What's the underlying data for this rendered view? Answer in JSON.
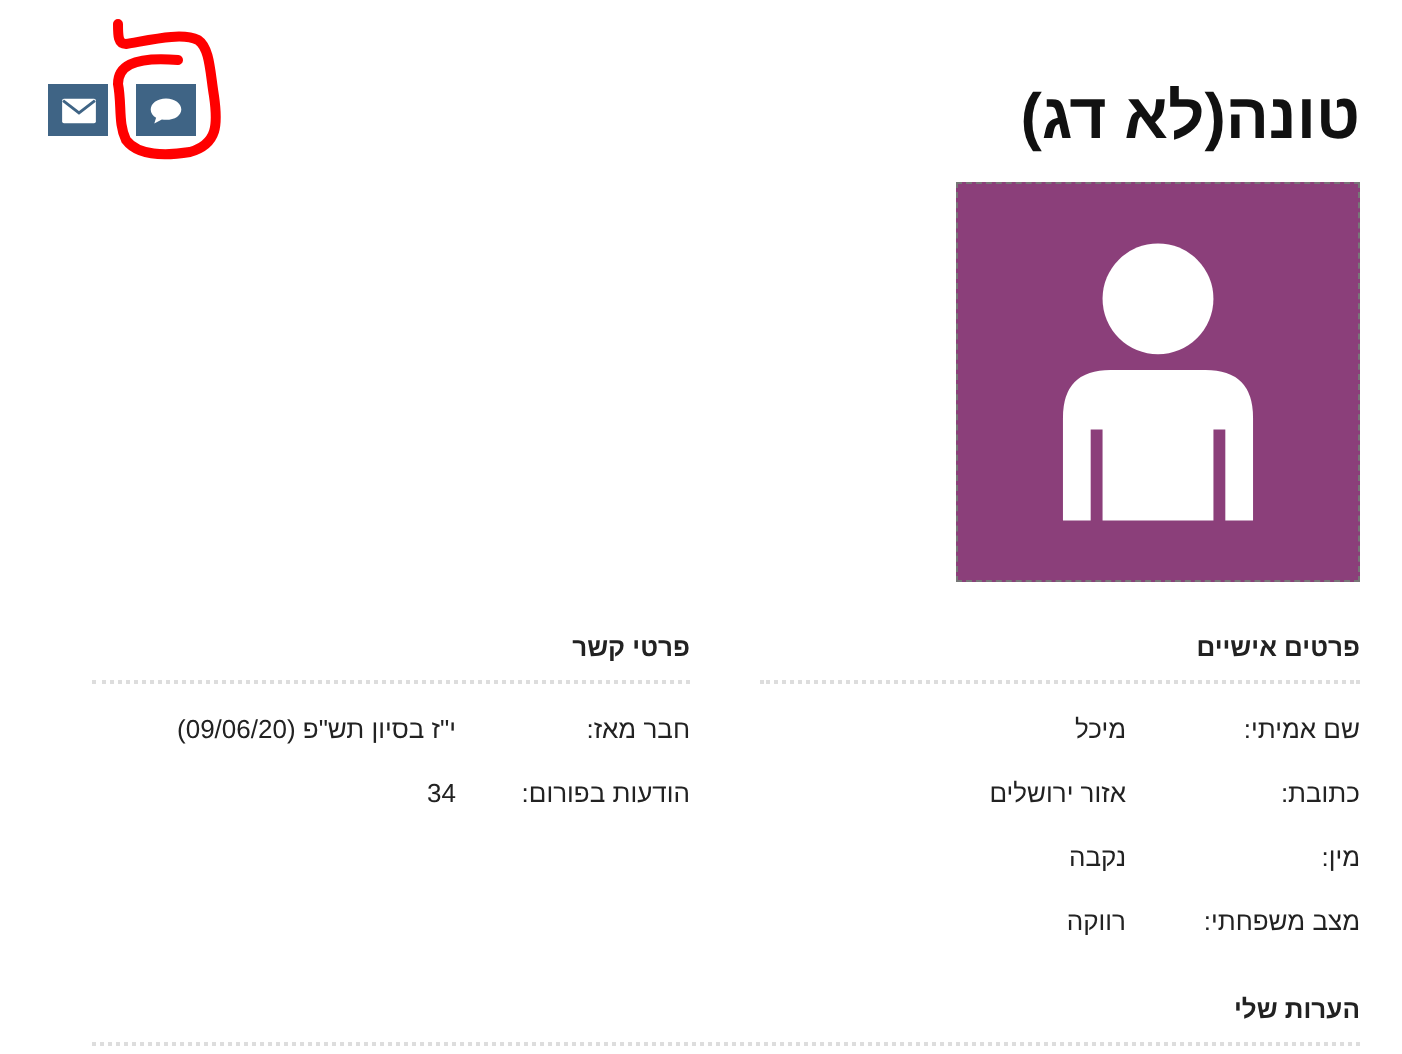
{
  "title": "טונה(לא דג)",
  "sections": [
    {
      "title": "פרטים אישיים",
      "fields": [
        {
          "label": "שם אמיתי:",
          "value": "מיכל"
        },
        {
          "label": "כתובת:",
          "value": "אזור ירושלים"
        },
        {
          "label": "מין:",
          "value": "נקבה"
        },
        {
          "label": "מצב משפחתי:",
          "value": "רווקה"
        }
      ]
    },
    {
      "title": "פרטי קשר",
      "fields": [
        {
          "label": "חבר מאז:",
          "value": "י\"ז בסיון תש\"פ (09/06/20)"
        },
        {
          "label": "הודעות בפורום:",
          "value": "34"
        }
      ]
    }
  ],
  "notes": {
    "title": "הערות שלי"
  }
}
